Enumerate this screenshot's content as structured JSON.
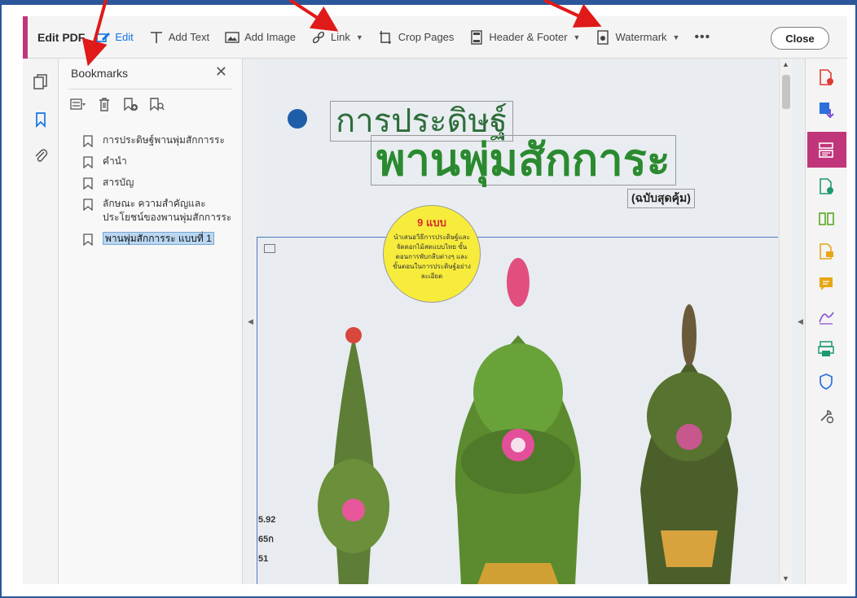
{
  "toolbar": {
    "title": "Edit PDF",
    "edit_label": "Edit",
    "add_text_label": "Add Text",
    "add_image_label": "Add Image",
    "link_label": "Link",
    "crop_label": "Crop Pages",
    "header_footer_label": "Header & Footer",
    "watermark_label": "Watermark",
    "more_label": "•••",
    "close_label": "Close"
  },
  "bookmarks": {
    "title": "Bookmarks",
    "close_glyph": "✕",
    "items": [
      {
        "label": "การประดิษฐ์พานพุ่มสักการระ",
        "selected": false
      },
      {
        "label": "คำนำ",
        "selected": false
      },
      {
        "label": "สารบัญ",
        "selected": false
      },
      {
        "label": "ลักษณะ ความสำคัญและประโยชน์ของพานพุ่มสักการระ",
        "selected": false
      },
      {
        "label": "พานพุ่มสักการระ แบบที่ 1",
        "selected": true
      }
    ]
  },
  "document": {
    "title_line1": "การประดิษฐ์",
    "title_line2": "พานพุ่มสักการะ",
    "subtitle": "(ฉบับสุดคุ้ม)",
    "badge_title": "9 แบบ",
    "badge_body": "นำเสนอวิธีการประดิษฐ์และจัดดอกไม้สดแบบไทย ขั้นตอนการพับกลีบต่างๆ และขั้นตอนในการประดิษฐ์อย่างละเอียด",
    "side_numbers": [
      "5.92",
      "65ก",
      "51"
    ]
  },
  "colors": {
    "accent": "#c1367a",
    "active_blue": "#1473e6",
    "frame_blue": "#2b579a",
    "arrow_red": "#e01919"
  },
  "icons": {
    "left_rail": [
      "pages-icon",
      "bookmark-icon",
      "attachment-icon"
    ],
    "right_rail": [
      "create-pdf-icon",
      "export-pdf-icon",
      "edit-pdf-icon",
      "combine-files-icon",
      "organize-pages-icon",
      "comment-icon",
      "fill-sign-icon",
      "send-for-signature-icon",
      "print-production-icon",
      "protect-icon",
      "more-tools-icon"
    ]
  }
}
